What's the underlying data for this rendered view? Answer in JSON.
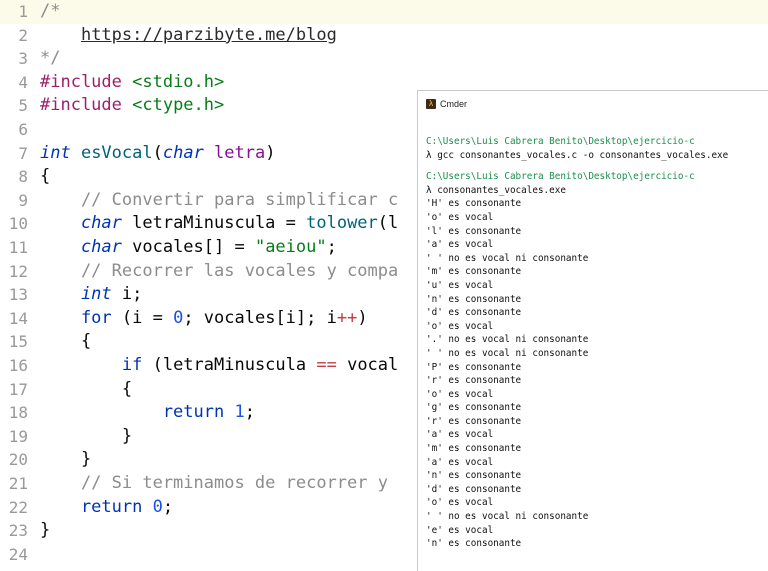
{
  "editor": {
    "lines": [
      {
        "n": "1",
        "tokens": [
          [
            "c-comment",
            "/*"
          ]
        ]
      },
      {
        "n": "2",
        "tokens": [
          [
            "c-plain",
            "    "
          ],
          [
            "c-link",
            "https://parzibyte.me/blog"
          ]
        ]
      },
      {
        "n": "3",
        "tokens": [
          [
            "c-comment",
            "*/"
          ]
        ]
      },
      {
        "n": "4",
        "tokens": [
          [
            "c-pre",
            "#include "
          ],
          [
            "c-inc",
            "<stdio.h>"
          ]
        ]
      },
      {
        "n": "5",
        "tokens": [
          [
            "c-pre",
            "#include "
          ],
          [
            "c-inc",
            "<ctype.h>"
          ]
        ]
      },
      {
        "n": "6",
        "tokens": []
      },
      {
        "n": "7",
        "tokens": [
          [
            "c-type",
            "int "
          ],
          [
            "c-fn",
            "esVocal"
          ],
          [
            "c-plain",
            "("
          ],
          [
            "c-type",
            "char "
          ],
          [
            "c-param",
            "letra"
          ],
          [
            "c-plain",
            ")"
          ]
        ]
      },
      {
        "n": "8",
        "tokens": [
          [
            "c-plain",
            "{"
          ]
        ]
      },
      {
        "n": "9",
        "tokens": [
          [
            "c-comment",
            "    // Convertir para simplificar c"
          ]
        ]
      },
      {
        "n": "10",
        "tokens": [
          [
            "c-type",
            "    char "
          ],
          [
            "c-plain",
            "letraMinuscula = "
          ],
          [
            "c-fn",
            "tolower"
          ],
          [
            "c-plain",
            "(l"
          ]
        ]
      },
      {
        "n": "11",
        "tokens": [
          [
            "c-type",
            "    char "
          ],
          [
            "c-plain",
            "vocales[] = "
          ],
          [
            "c-str",
            "\"aeiou\""
          ],
          [
            "c-plain",
            ";"
          ]
        ]
      },
      {
        "n": "12",
        "tokens": [
          [
            "c-comment",
            "    // Recorrer las vocales y compa"
          ]
        ]
      },
      {
        "n": "13",
        "tokens": [
          [
            "c-type",
            "    int "
          ],
          [
            "c-plain",
            "i;"
          ]
        ]
      },
      {
        "n": "14",
        "tokens": [
          [
            "c-kw",
            "    for "
          ],
          [
            "c-plain",
            "(i = "
          ],
          [
            "c-num",
            "0"
          ],
          [
            "c-plain",
            "; vocales[i]; i"
          ],
          [
            "c-op",
            "++"
          ],
          [
            "c-plain",
            ")"
          ]
        ]
      },
      {
        "n": "15",
        "tokens": [
          [
            "c-plain",
            "    {"
          ]
        ]
      },
      {
        "n": "16",
        "tokens": [
          [
            "c-kw",
            "        if "
          ],
          [
            "c-plain",
            "(letraMinuscula "
          ],
          [
            "c-op",
            "=="
          ],
          [
            "c-plain",
            " vocal"
          ]
        ]
      },
      {
        "n": "17",
        "tokens": [
          [
            "c-plain",
            "        {"
          ]
        ]
      },
      {
        "n": "18",
        "tokens": [
          [
            "c-kw",
            "            return "
          ],
          [
            "c-num",
            "1"
          ],
          [
            "c-plain",
            ";"
          ]
        ]
      },
      {
        "n": "19",
        "tokens": [
          [
            "c-plain",
            "        }"
          ]
        ]
      },
      {
        "n": "20",
        "tokens": [
          [
            "c-plain",
            "    }"
          ]
        ]
      },
      {
        "n": "21",
        "tokens": [
          [
            "c-comment",
            "    // Si terminamos de recorrer y "
          ]
        ]
      },
      {
        "n": "22",
        "tokens": [
          [
            "c-kw",
            "    return "
          ],
          [
            "c-num",
            "0"
          ],
          [
            "c-plain",
            ";"
          ]
        ]
      },
      {
        "n": "23",
        "tokens": [
          [
            "c-plain",
            "}"
          ]
        ]
      },
      {
        "n": "24",
        "tokens": []
      }
    ]
  },
  "cmder": {
    "title": "Cmder",
    "lines": [
      {
        "t": "C:\\Users\\Luis Cabrera Benito\\Desktop\\ejercicio-c",
        "k": "path"
      },
      {
        "t": "λ gcc consonantes_vocales.c -o consonantes_vocales.exe",
        "k": ""
      },
      {
        "t": "",
        "k": "gap"
      },
      {
        "t": "C:\\Users\\Luis Cabrera Benito\\Desktop\\ejercicio-c",
        "k": "path"
      },
      {
        "t": "λ consonantes_vocales.exe",
        "k": ""
      },
      {
        "t": "'H' es consonante",
        "k": ""
      },
      {
        "t": "'o' es vocal",
        "k": ""
      },
      {
        "t": "'l' es consonante",
        "k": ""
      },
      {
        "t": "'a' es vocal",
        "k": ""
      },
      {
        "t": "' ' no es vocal ni consonante",
        "k": ""
      },
      {
        "t": "'m' es consonante",
        "k": ""
      },
      {
        "t": "'u' es vocal",
        "k": ""
      },
      {
        "t": "'n' es consonante",
        "k": ""
      },
      {
        "t": "'d' es consonante",
        "k": ""
      },
      {
        "t": "'o' es vocal",
        "k": ""
      },
      {
        "t": "'.' no es vocal ni consonante",
        "k": ""
      },
      {
        "t": "' ' no es vocal ni consonante",
        "k": ""
      },
      {
        "t": "'P' es consonante",
        "k": ""
      },
      {
        "t": "'r' es consonante",
        "k": ""
      },
      {
        "t": "'o' es vocal",
        "k": ""
      },
      {
        "t": "'g' es consonante",
        "k": ""
      },
      {
        "t": "'r' es consonante",
        "k": ""
      },
      {
        "t": "'a' es vocal",
        "k": ""
      },
      {
        "t": "'m' es consonante",
        "k": ""
      },
      {
        "t": "'a' es vocal",
        "k": ""
      },
      {
        "t": "'n' es consonante",
        "k": ""
      },
      {
        "t": "'d' es consonante",
        "k": ""
      },
      {
        "t": "'o' es vocal",
        "k": ""
      },
      {
        "t": "' ' no es vocal ni consonante",
        "k": ""
      },
      {
        "t": "'e' es vocal",
        "k": ""
      },
      {
        "t": "'n' es consonante",
        "k": ""
      }
    ]
  },
  "colors": {
    "accent": "#0033b3",
    "string": "#067d17",
    "comment": "#8c8c8c",
    "path": "#1a8f4d"
  }
}
